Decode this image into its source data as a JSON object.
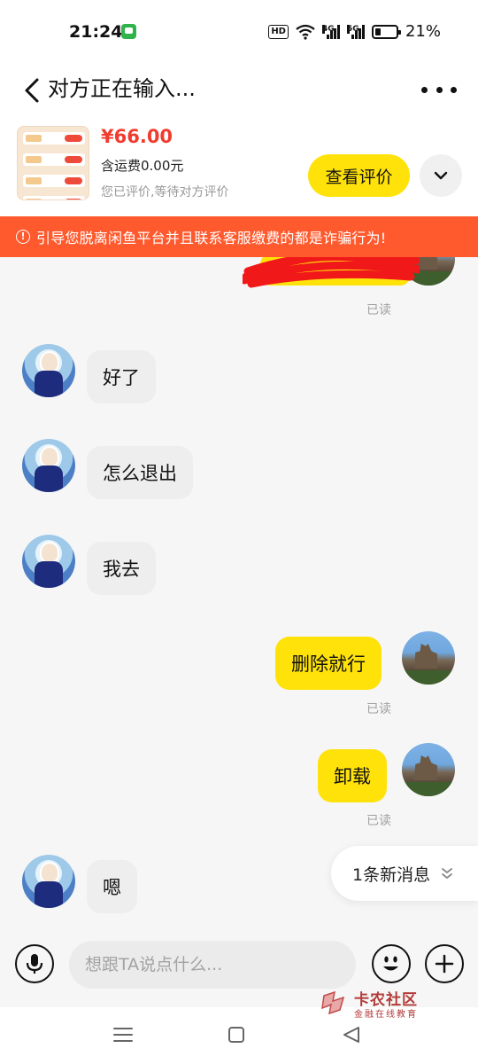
{
  "status_bar": {
    "time": "21:24",
    "hd_badge": "HD",
    "net1": "4G",
    "net2": "5G",
    "battery": "21%"
  },
  "header": {
    "title": "对方正在输入...",
    "back_icon": "chevron-left-icon",
    "more_icon": "more-horizontal-icon"
  },
  "product": {
    "price": "¥66.00",
    "shipping": "含运费0.00元",
    "status": "您已评价,等待对方评价",
    "review_button": "查看评价",
    "expand_icon": "chevron-down-icon"
  },
  "warning": {
    "icon": "!",
    "text": "引导您脱离闲鱼平台并且联系客服缴费的都是诈骗行为!"
  },
  "messages": [
    {
      "side": "out",
      "text": "",
      "read": "已读",
      "redacted": true
    },
    {
      "side": "in",
      "text": "好了"
    },
    {
      "side": "in",
      "text": "怎么退出"
    },
    {
      "side": "in",
      "text": "我去"
    },
    {
      "side": "out",
      "text": "删除就行",
      "read": "已读"
    },
    {
      "side": "out",
      "text": "卸载",
      "read": "已读"
    },
    {
      "side": "in",
      "text": "嗯"
    }
  ],
  "new_messages": {
    "label": "1条新消息",
    "icon": "double-chevron-down-icon"
  },
  "input_bar": {
    "placeholder": "想跟TA说点什么...",
    "voice_icon": "microphone-icon",
    "emoji_icon": "emoji-smile-icon",
    "plus_icon": "plus-icon"
  },
  "watermark": {
    "title": "卡农社区",
    "subtitle": "金融在线教育"
  },
  "colors": {
    "accent_yellow": "#ffe20a",
    "warning_orange": "#ff5a2e",
    "price_red": "#f23b2f"
  }
}
